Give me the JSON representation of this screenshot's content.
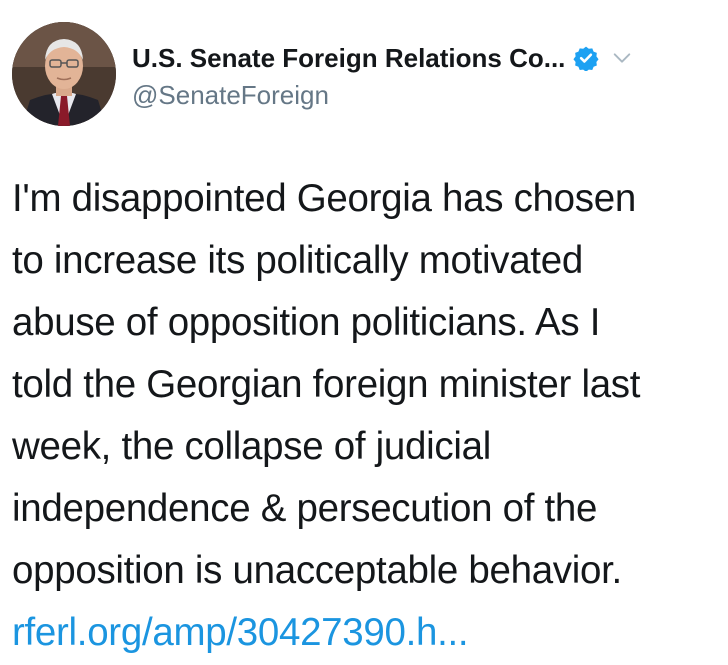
{
  "tweet": {
    "author": {
      "display_name": "U.S. Senate Foreign Relations Co...",
      "handle": "@SenateForeign",
      "verified": true,
      "avatar_icon": "profile-photo-senator"
    },
    "menu_icon": "chevron-down-icon",
    "text_lines": [
      "I'm disappointed Georgia has chosen",
      "to increase its politically motivated",
      "abuse of opposition politicians. As I",
      "told the Georgian foreign minister last",
      "week, the collapse of judicial",
      "independence & persecution of the",
      "opposition is unacceptable behavior."
    ],
    "link_text": "rferl.org/amp/30427390.h...",
    "colors": {
      "link": "#1b95e0",
      "verified_badge": "#1da1f2",
      "handle": "#657786",
      "text": "#14171a"
    }
  }
}
